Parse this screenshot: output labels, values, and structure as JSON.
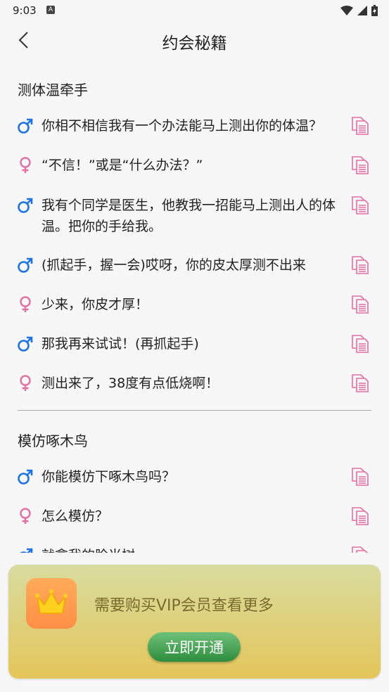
{
  "status_bar": {
    "time": "9:03",
    "notification_icon": "A"
  },
  "header": {
    "title": "约会秘籍",
    "back_icon": "chevron-left-icon"
  },
  "sections": [
    {
      "title": "测体温牵手",
      "lines": [
        {
          "gender": "male",
          "text": "你相不相信我有一个办法能马上测出你的体温？"
        },
        {
          "gender": "female",
          "text": "“不信！”或是“什么办法？”"
        },
        {
          "gender": "male",
          "text": "我有个同学是医生，他教我一招能马上测出人的体温。把你的手给我。"
        },
        {
          "gender": "male",
          "text": "(抓起手，握一会)哎呀，你的皮太厚测不出来"
        },
        {
          "gender": "female",
          "text": "少来，你皮才厚！"
        },
        {
          "gender": "male",
          "text": "那我再来试试！(再抓起手)"
        },
        {
          "gender": "female",
          "text": "测出来了，38度有点低烧啊！"
        }
      ]
    },
    {
      "title": "模仿啄木鸟",
      "lines": [
        {
          "gender": "male",
          "text": "你能模仿下啄木鸟吗？"
        },
        {
          "gender": "female",
          "text": "怎么模仿？"
        },
        {
          "gender": "male",
          "text": "就拿我的脸当树"
        }
      ]
    }
  ],
  "colors": {
    "male": "#1a73e8",
    "female": "#e56fa4",
    "copy": "#e56fa4"
  },
  "vip": {
    "message": "需要购买VIP会员查看更多",
    "button_label": "立即开通"
  }
}
